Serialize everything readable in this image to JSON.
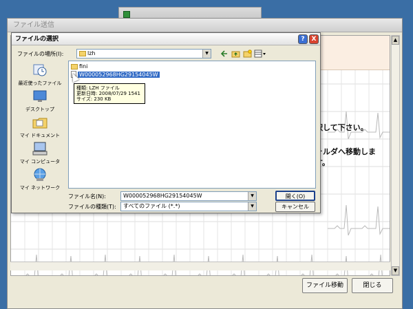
{
  "background_window": {
    "title": "ファイル送信",
    "top_title": ""
  },
  "background_content": {
    "text1": "択して下さい。",
    "text2": "ォルダへ移動します。"
  },
  "outer_buttons": {
    "move": "ファイル移動",
    "close": "閉じる"
  },
  "dialog": {
    "title": "ファイルの選択",
    "help": "?",
    "close": "X",
    "location_label": "ファイルの場所(I):",
    "location_value": "lzh",
    "sidebar": [
      {
        "label": "最近使ったファイル",
        "icon": "recent-icon"
      },
      {
        "label": "デスクトップ",
        "icon": "desktop-icon"
      },
      {
        "label": "マイ ドキュメント",
        "icon": "my-documents-icon"
      },
      {
        "label": "マイ コンピュータ",
        "icon": "my-computer-icon"
      },
      {
        "label": "マイ ネットワーク",
        "icon": "my-network-icon"
      }
    ],
    "files": [
      {
        "name": "fini",
        "type": "folder"
      },
      {
        "name": "W000052968HG29154045W",
        "type": "file",
        "selected": true
      }
    ],
    "tooltip": {
      "line1": "種類: LZH ファイル",
      "line2": "更新日時: 2008/07/29 1541",
      "line3": "サイズ: 230 KB"
    },
    "filename_label": "ファイル名(N):",
    "filename_value": "W000052968HG29154045W",
    "filetype_label": "ファイルの種類(T):",
    "filetype_value": "すべてのファイル (*.*)",
    "open_button": "開く(O)",
    "cancel_button": "キャンセル"
  },
  "colors": {
    "desktop": "#3a6ea5",
    "dialog_bg": "#ece9d8",
    "close_red": "#d9432f",
    "help_blue": "#3b6fd3",
    "ecg_grid": "#d2d2d2",
    "band": "#fbeee2"
  }
}
